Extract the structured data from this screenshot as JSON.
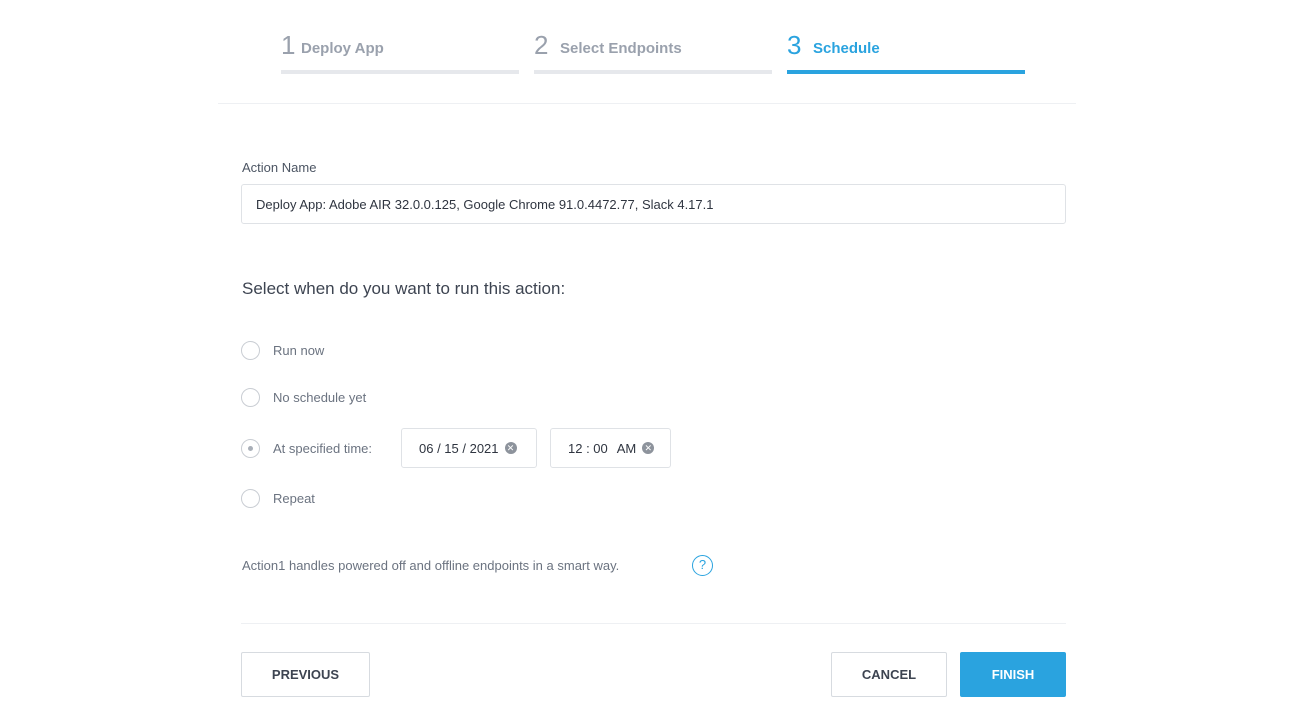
{
  "stepper": {
    "steps": [
      {
        "number": "1",
        "label": "Deploy App"
      },
      {
        "number": "2",
        "label": "Select Endpoints"
      },
      {
        "number": "3",
        "label": "Schedule"
      }
    ],
    "active_step": 3
  },
  "form": {
    "action_name_label": "Action Name",
    "action_name_value": "Deploy App: Adobe AIR 32.0.0.125, Google Chrome 91.0.4472.77, Slack 4.17.1",
    "schedule_title": "Select when do you want to run this action:",
    "options": [
      {
        "label": "Run now",
        "checked": false
      },
      {
        "label": "No schedule yet",
        "checked": false
      },
      {
        "label": "At specified time:",
        "checked": true
      },
      {
        "label": "Repeat",
        "checked": false
      }
    ],
    "date_value": "06 / 15 / 2021",
    "time_value": "12 : 00",
    "time_period": "AM",
    "hint": "Action1 handles powered off and offline endpoints in a smart way.",
    "help_glyph": "?"
  },
  "footer": {
    "previous_label": "PREVIOUS",
    "cancel_label": "CANCEL",
    "finish_label": "FINISH"
  },
  "colors": {
    "accent": "#2aa3df",
    "inactive": "#9aa1ad",
    "border": "#dfe2e6"
  }
}
